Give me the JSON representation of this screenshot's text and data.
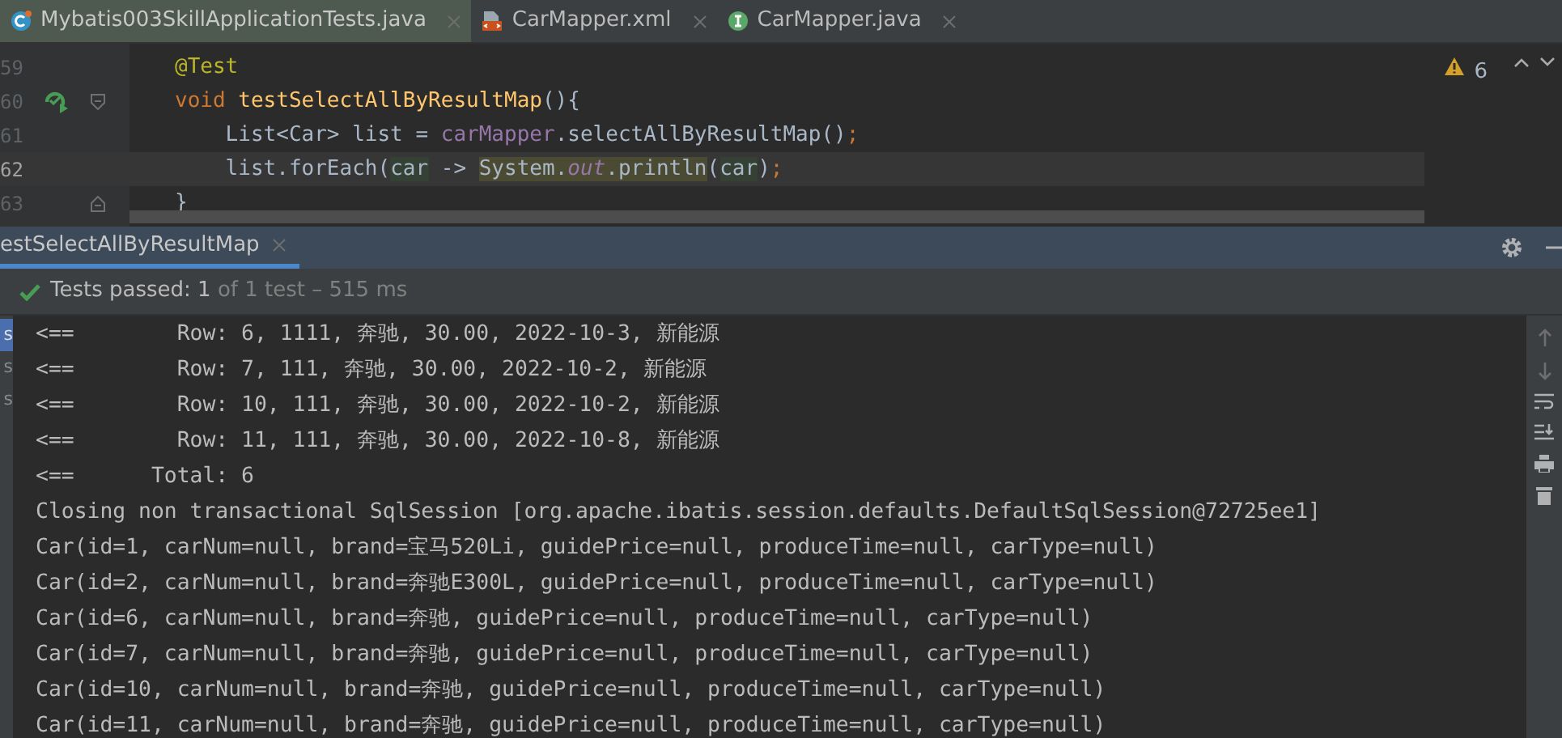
{
  "editor_tabs": [
    {
      "label": "Mybatis003SkillApplicationTests.java",
      "kind": "test-class",
      "selected": true
    },
    {
      "label": "CarMapper.xml",
      "kind": "xml",
      "selected": false
    },
    {
      "label": "CarMapper.java",
      "kind": "interface",
      "selected": false
    }
  ],
  "editor": {
    "warnings": "6",
    "lines": [
      {
        "number": "59",
        "current": false,
        "run_button": false,
        "fold_start": false,
        "fold_end": false,
        "segments": [
          {
            "kind": "annotation",
            "text": "@Test"
          }
        ]
      },
      {
        "number": "60",
        "current": false,
        "run_button": true,
        "fold_start": true,
        "fold_end": false,
        "segments": [
          {
            "kind": "keyword",
            "text": "void "
          },
          {
            "kind": "method",
            "text": "testSelectAllByResultMap"
          },
          {
            "kind": "plain",
            "text": "(){"
          }
        ]
      },
      {
        "number": "61",
        "current": false,
        "run_button": false,
        "fold_start": false,
        "fold_end": false,
        "segments": [
          {
            "kind": "plain",
            "text": "    List<Car> list = "
          },
          {
            "kind": "field",
            "text": "carMapper"
          },
          {
            "kind": "plain",
            "text": ".selectAllByResultMap()"
          },
          {
            "kind": "punct",
            "text": ";"
          }
        ]
      },
      {
        "number": "62",
        "current": true,
        "run_button": false,
        "fold_start": false,
        "fold_end": false,
        "segments": [
          {
            "kind": "plain",
            "text": "    list.forEach("
          },
          {
            "kind": "param",
            "text": "car"
          },
          {
            "kind": "plain",
            "text": " -> "
          },
          {
            "kind": "usage",
            "text": "System."
          },
          {
            "kind": "static",
            "text": "out"
          },
          {
            "kind": "usage",
            "text": ".println"
          },
          {
            "kind": "plain",
            "text": "("
          },
          {
            "kind": "param",
            "text": "car"
          },
          {
            "kind": "plain",
            "text": ")"
          },
          {
            "kind": "punct",
            "text": ";"
          }
        ]
      },
      {
        "number": "63",
        "current": false,
        "run_button": false,
        "fold_start": false,
        "fold_end": true,
        "segments": [
          {
            "kind": "plain",
            "text": "}"
          }
        ]
      }
    ]
  },
  "run_panel": {
    "tab": "estSelectAllByResultMap",
    "status": {
      "label": "Tests passed:",
      "count": "1",
      "detail": "of 1 test – 515 ms"
    },
    "test_tree": [
      {
        "label": "s",
        "selected": true
      },
      {
        "label": "s",
        "selected": false
      },
      {
        "label": "s",
        "selected": false
      }
    ],
    "console": [
      "<==        Row: 6, 1111, 奔驰, 30.00, 2022-10-3, 新能源",
      "<==        Row: 7, 111, 奔驰, 30.00, 2022-10-2, 新能源",
      "<==        Row: 10, 111, 奔驰, 30.00, 2022-10-2, 新能源",
      "<==        Row: 11, 111, 奔驰, 30.00, 2022-10-8, 新能源",
      "<==      Total: 6",
      "Closing non transactional SqlSession [org.apache.ibatis.session.defaults.DefaultSqlSession@72725ee1]",
      "Car(id=1, carNum=null, brand=宝马520Li, guidePrice=null, produceTime=null, carType=null)",
      "Car(id=2, carNum=null, brand=奔驰E300L, guidePrice=null, produceTime=null, carType=null)",
      "Car(id=6, carNum=null, brand=奔驰, guidePrice=null, produceTime=null, carType=null)",
      "Car(id=7, carNum=null, brand=奔驰, guidePrice=null, produceTime=null, carType=null)",
      "Car(id=10, carNum=null, brand=奔驰, guidePrice=null, produceTime=null, carType=null)",
      "Car(id=11, carNum=null, brand=奔驰, guidePrice=null, produceTime=null, carType=null)"
    ]
  }
}
